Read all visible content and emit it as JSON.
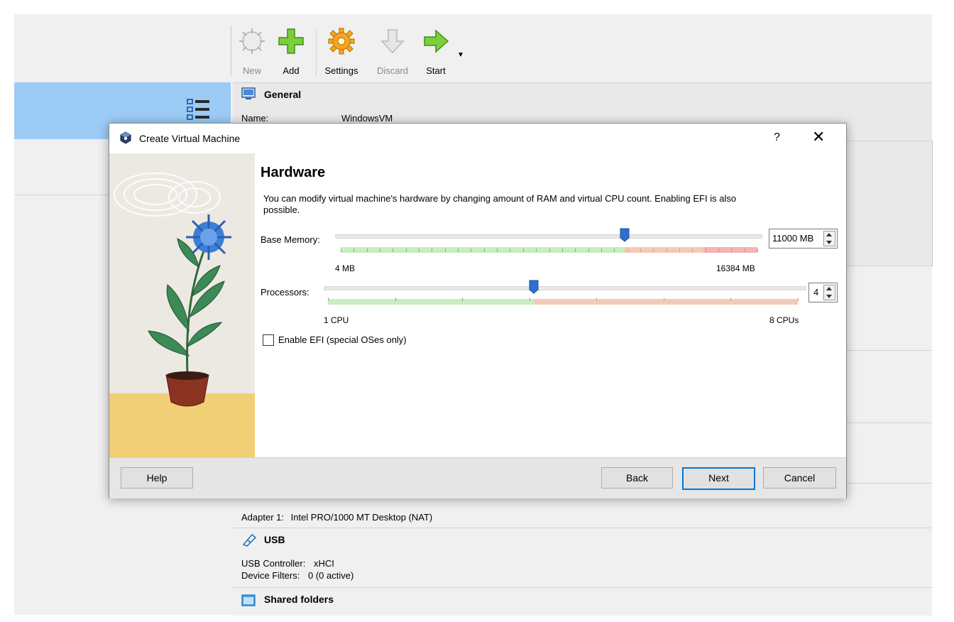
{
  "toolbar": {
    "new_label": "New",
    "add_label": "Add",
    "settings_label": "Settings",
    "discard_label": "Discard",
    "start_label": "Start"
  },
  "details": {
    "general": {
      "title": "General",
      "name_key": "Name:",
      "name_value": "WindowsVM"
    },
    "network": {
      "adapter_key": "Adapter 1:",
      "adapter_value": "Intel PRO/1000 MT Desktop (NAT)"
    },
    "usb": {
      "title": "USB",
      "controller_key": "USB Controller:",
      "controller_value": "xHCI",
      "filters_key": "Device Filters:",
      "filters_value": "0 (0 active)"
    },
    "shared_folders": {
      "title": "Shared folders"
    }
  },
  "dialog": {
    "title": "Create Virtual Machine",
    "help_glyph": "?",
    "close_glyph": "✕",
    "page_title": "Hardware",
    "description": "You can modify virtual machine's hardware by changing amount of RAM and virtual CPU count. Enabling EFI is also possible.",
    "memory": {
      "label": "Base Memory:",
      "value_text": "11000 MB",
      "min_label": "4 MB",
      "max_label": "16384 MB",
      "min": 4,
      "max": 16384,
      "value": 11000,
      "recommended_max": 11000
    },
    "processors": {
      "label": "Processors:",
      "value_text": "4",
      "min_label": "1 CPU",
      "max_label": "8 CPUs",
      "min": 1,
      "max": 8,
      "value": 4
    },
    "efi": {
      "label": "Enable EFI (special OSes only)",
      "checked": false
    },
    "buttons": {
      "help": "Help",
      "back": "Back",
      "next": "Next",
      "cancel": "Cancel"
    }
  },
  "colors": {
    "selection": "#9ccbf5",
    "slider_green": "#c9ecc1",
    "slider_orange": "#f2cbb8",
    "slider_red": "#f2b4b4",
    "handle_blue": "#2f6fd0",
    "accent": "#0078d7"
  }
}
